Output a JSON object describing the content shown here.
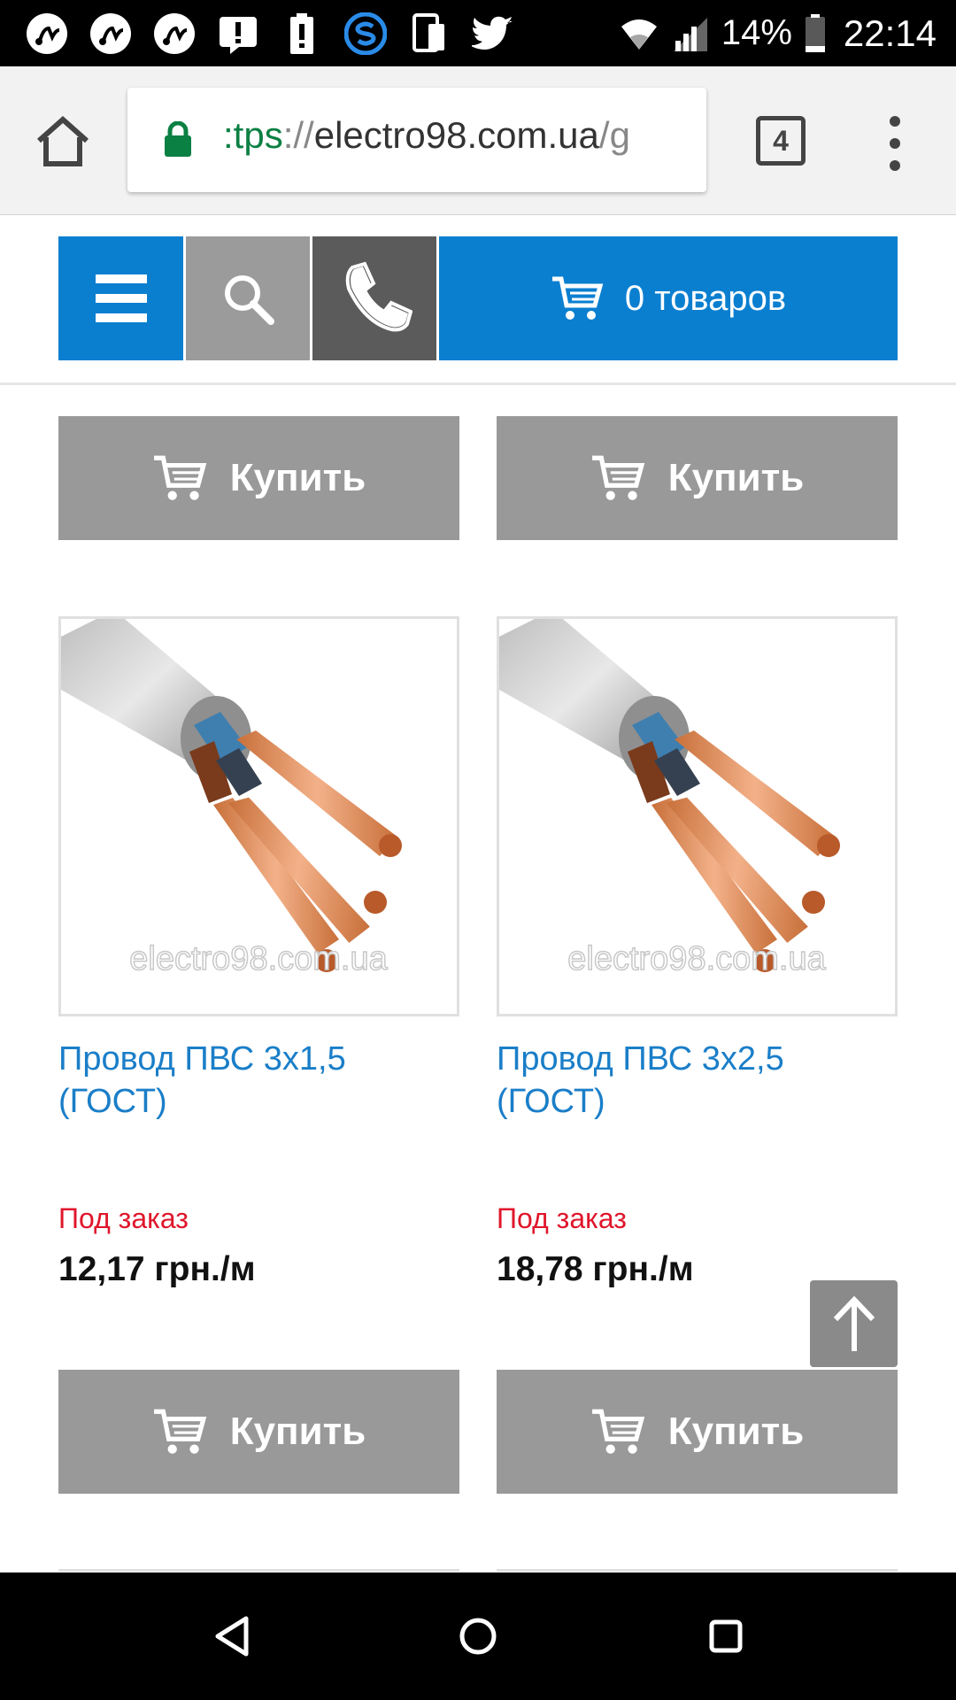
{
  "status_bar": {
    "battery_percent": "14%",
    "time": "22:14",
    "icons": [
      "app-icon",
      "app-icon",
      "app-icon",
      "alert-icon",
      "battery-alert-icon",
      "skype-icon",
      "phone-sync-icon",
      "twitter-icon"
    ]
  },
  "browser": {
    "url_scheme": ":tps",
    "url_sep": "://",
    "url_host": "electro98.com.ua",
    "url_tail": "/g",
    "tab_count": "4"
  },
  "site_nav": {
    "cart_label": "0 товаров"
  },
  "products_top_row": {
    "buy_label": "Купить"
  },
  "products": [
    {
      "title": "Провод ПВС 3х1,5 (ГОСТ)",
      "status": "Под заказ",
      "price": "12,17 грн./м",
      "buy_label": "Купить",
      "watermark": "electro98.com.ua"
    },
    {
      "title": "Провод ПВС 3х2,5 (ГОСТ)",
      "status": "Под заказ",
      "price": "18,78 грн./м",
      "buy_label": "Купить",
      "watermark": "electro98.com.ua"
    }
  ],
  "colors": {
    "accent": "#0a7fd0",
    "status_red": "#e0162b",
    "button_grey": "#999999"
  }
}
